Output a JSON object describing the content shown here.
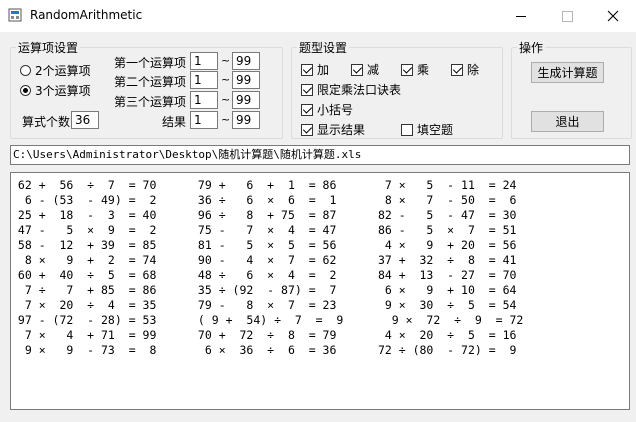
{
  "window": {
    "title": "RandomArithmetic"
  },
  "operand_settings": {
    "legend": "运算项设置",
    "radio_2": "2个运算项",
    "radio_3": "3个运算项",
    "selected": 3,
    "count_label": "算式个数",
    "count_value": "36",
    "tilde": "~",
    "rows": [
      {
        "label": "第一个运算项",
        "min": "1",
        "max": "99"
      },
      {
        "label": "第二个运算项",
        "min": "1",
        "max": "99"
      },
      {
        "label": "第三个运算项",
        "min": "1",
        "max": "99"
      },
      {
        "label": "结果",
        "min": "1",
        "max": "99"
      }
    ]
  },
  "question_type": {
    "legend": "题型设置",
    "add": "加",
    "sub": "减",
    "mul": "乘",
    "div": "除",
    "limit_table": "限定乘法口诀表",
    "brackets": "小括号",
    "show_result": "显示结果",
    "fill_blank": "填空题",
    "checked": {
      "add": true,
      "sub": true,
      "mul": true,
      "div": true,
      "limit_table": true,
      "brackets": true,
      "show_result": true,
      "fill_blank": false
    }
  },
  "operations": {
    "legend": "操作",
    "generate": "生成计算题",
    "exit": "退出"
  },
  "path": "C:\\Users\\Administrator\\Desktop\\随机计算题\\随机计算题.xls",
  "output_lines": [
    " 62 +  56  ÷  7  = 70      79 +   6  +  1  = 86       7 ×   5  - 11  = 24",
    "  6 - (53  - 49) =  2      36 ÷   6  ×  6  =  1       8 ×   7  - 50  =  6",
    " 25 +  18  -  3  = 40      96 ÷   8  + 75  = 87      82 -   5  - 47  = 30",
    " 47 -   5  ×  9  =  2      75 -   7  ×  4  = 47      86 -   5  ×  7  = 51",
    " 58 -  12  + 39  = 85      81 -   5  ×  5  = 56       4 ×   9  + 20  = 56",
    "  8 ×   9  +  2  = 74      90 -   4  ×  7  = 62      37 +  32  ÷  8  = 41",
    " 60 +  40  ÷  5  = 68      48 ÷   6  ×  4  =  2      84 +  13  - 27  = 70",
    "  7 ÷   7  + 85  = 86      35 ÷ (92  - 87) =  7       6 ×   9  + 10  = 64",
    "  7 ×  20  ÷  4  = 35      79 -   8  ×  7  = 23       9 ×  30  ÷  5  = 54",
    " 97 - (72  - 28) = 53      ( 9 +  54) ÷  7  =  9       9 ×  72  ÷  9  = 72",
    "  7 ×   4  + 71  = 99      70 +  72  ÷  8  = 79       4 ×  20  ÷  5  = 16",
    "  9 ×   9  - 73  =  8       6 ×  36  ÷  6  = 36      72 ÷ (80  - 72) =  9"
  ]
}
